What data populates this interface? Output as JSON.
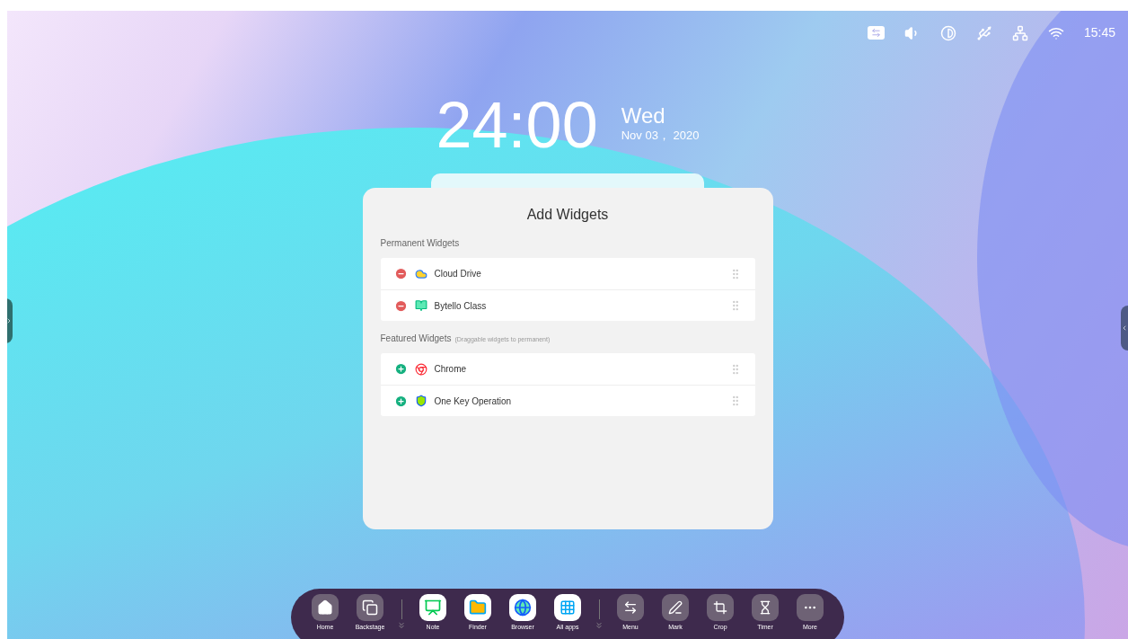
{
  "status_bar": {
    "time": "15:45"
  },
  "clock": {
    "time": "24:00",
    "weekday": "Wed",
    "date": "Nov 03， 2020"
  },
  "panel": {
    "title": "Add Widgets",
    "sections": [
      {
        "title": "Permanent Widgets",
        "items": [
          {
            "label": "Cloud Drive",
            "kind": "remove"
          },
          {
            "label": "Bytello Class",
            "kind": "remove"
          }
        ]
      },
      {
        "title": "Featured Widgets",
        "hint": "(Draggable widgets to permanent)",
        "items": [
          {
            "label": "Chrome",
            "kind": "add"
          },
          {
            "label": "One Key Operation",
            "kind": "add"
          }
        ]
      }
    ]
  },
  "dock": {
    "groups": [
      [
        {
          "label": "Home",
          "kind": "system"
        },
        {
          "label": "Backstage",
          "kind": "system"
        }
      ],
      [
        {
          "label": "Note",
          "kind": "app"
        },
        {
          "label": "Finder",
          "kind": "app"
        },
        {
          "label": "Browser",
          "kind": "app"
        },
        {
          "label": "All apps",
          "kind": "app"
        }
      ],
      [
        {
          "label": "Menu",
          "kind": "system"
        },
        {
          "label": "Mark",
          "kind": "system"
        },
        {
          "label": "Crop",
          "kind": "system"
        },
        {
          "label": "Timer",
          "kind": "system"
        },
        {
          "label": "More",
          "kind": "system"
        }
      ]
    ]
  }
}
